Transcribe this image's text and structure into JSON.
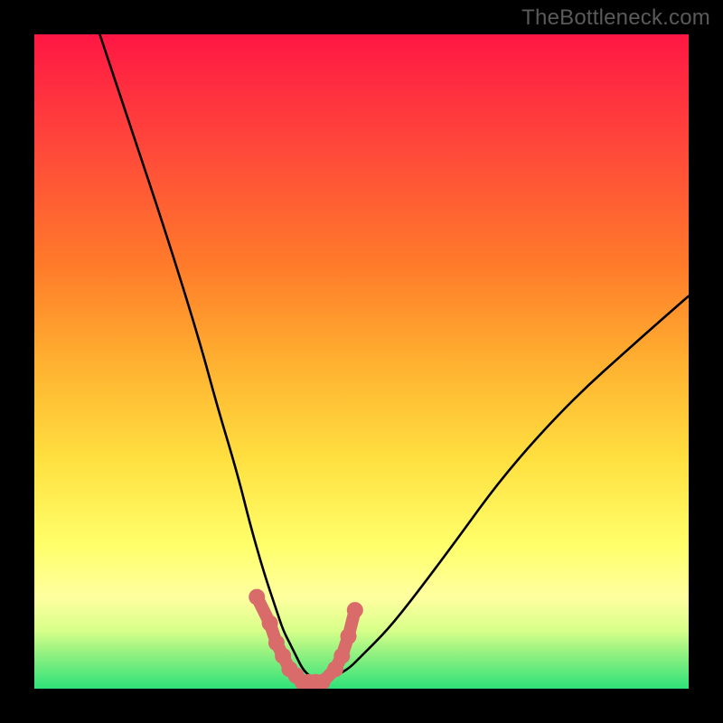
{
  "watermark": "TheBottleneck.com",
  "chart_data": {
    "type": "line",
    "title": "",
    "xlabel": "",
    "ylabel": "",
    "xlim": [
      0,
      100
    ],
    "ylim": [
      0,
      100
    ],
    "series": [
      {
        "name": "bottleneck-curve",
        "x": [
          10,
          15,
          20,
          25,
          28,
          31,
          33,
          35,
          37,
          38,
          39,
          40,
          41,
          42,
          43,
          44,
          46,
          48,
          50,
          54,
          58,
          64,
          72,
          82,
          92,
          100
        ],
        "values": [
          100,
          85,
          70,
          54,
          43,
          33,
          25,
          18,
          12,
          9,
          7,
          5,
          3,
          2,
          1,
          1,
          2,
          3,
          5,
          9,
          14,
          22,
          33,
          44,
          53,
          60
        ]
      }
    ],
    "markers": {
      "name": "highlighted-points",
      "color": "#d96b6b",
      "x": [
        34,
        36,
        37,
        38,
        39,
        40,
        41,
        42,
        43,
        44,
        46,
        47,
        48,
        49
      ],
      "values": [
        14,
        10,
        7,
        5,
        3,
        2,
        1,
        1,
        1,
        1,
        3,
        5,
        8,
        12
      ]
    },
    "gradient_stops": [
      {
        "pos": 0,
        "color": "#ff1744"
      },
      {
        "pos": 18,
        "color": "#ff4a3a"
      },
      {
        "pos": 35,
        "color": "#ff7a2a"
      },
      {
        "pos": 50,
        "color": "#ffb030"
      },
      {
        "pos": 65,
        "color": "#ffe040"
      },
      {
        "pos": 78,
        "color": "#ffff6a"
      },
      {
        "pos": 86,
        "color": "#ffffa0"
      },
      {
        "pos": 91,
        "color": "#d9ff8a"
      },
      {
        "pos": 95,
        "color": "#8cf080"
      },
      {
        "pos": 100,
        "color": "#2ee27a"
      }
    ]
  }
}
